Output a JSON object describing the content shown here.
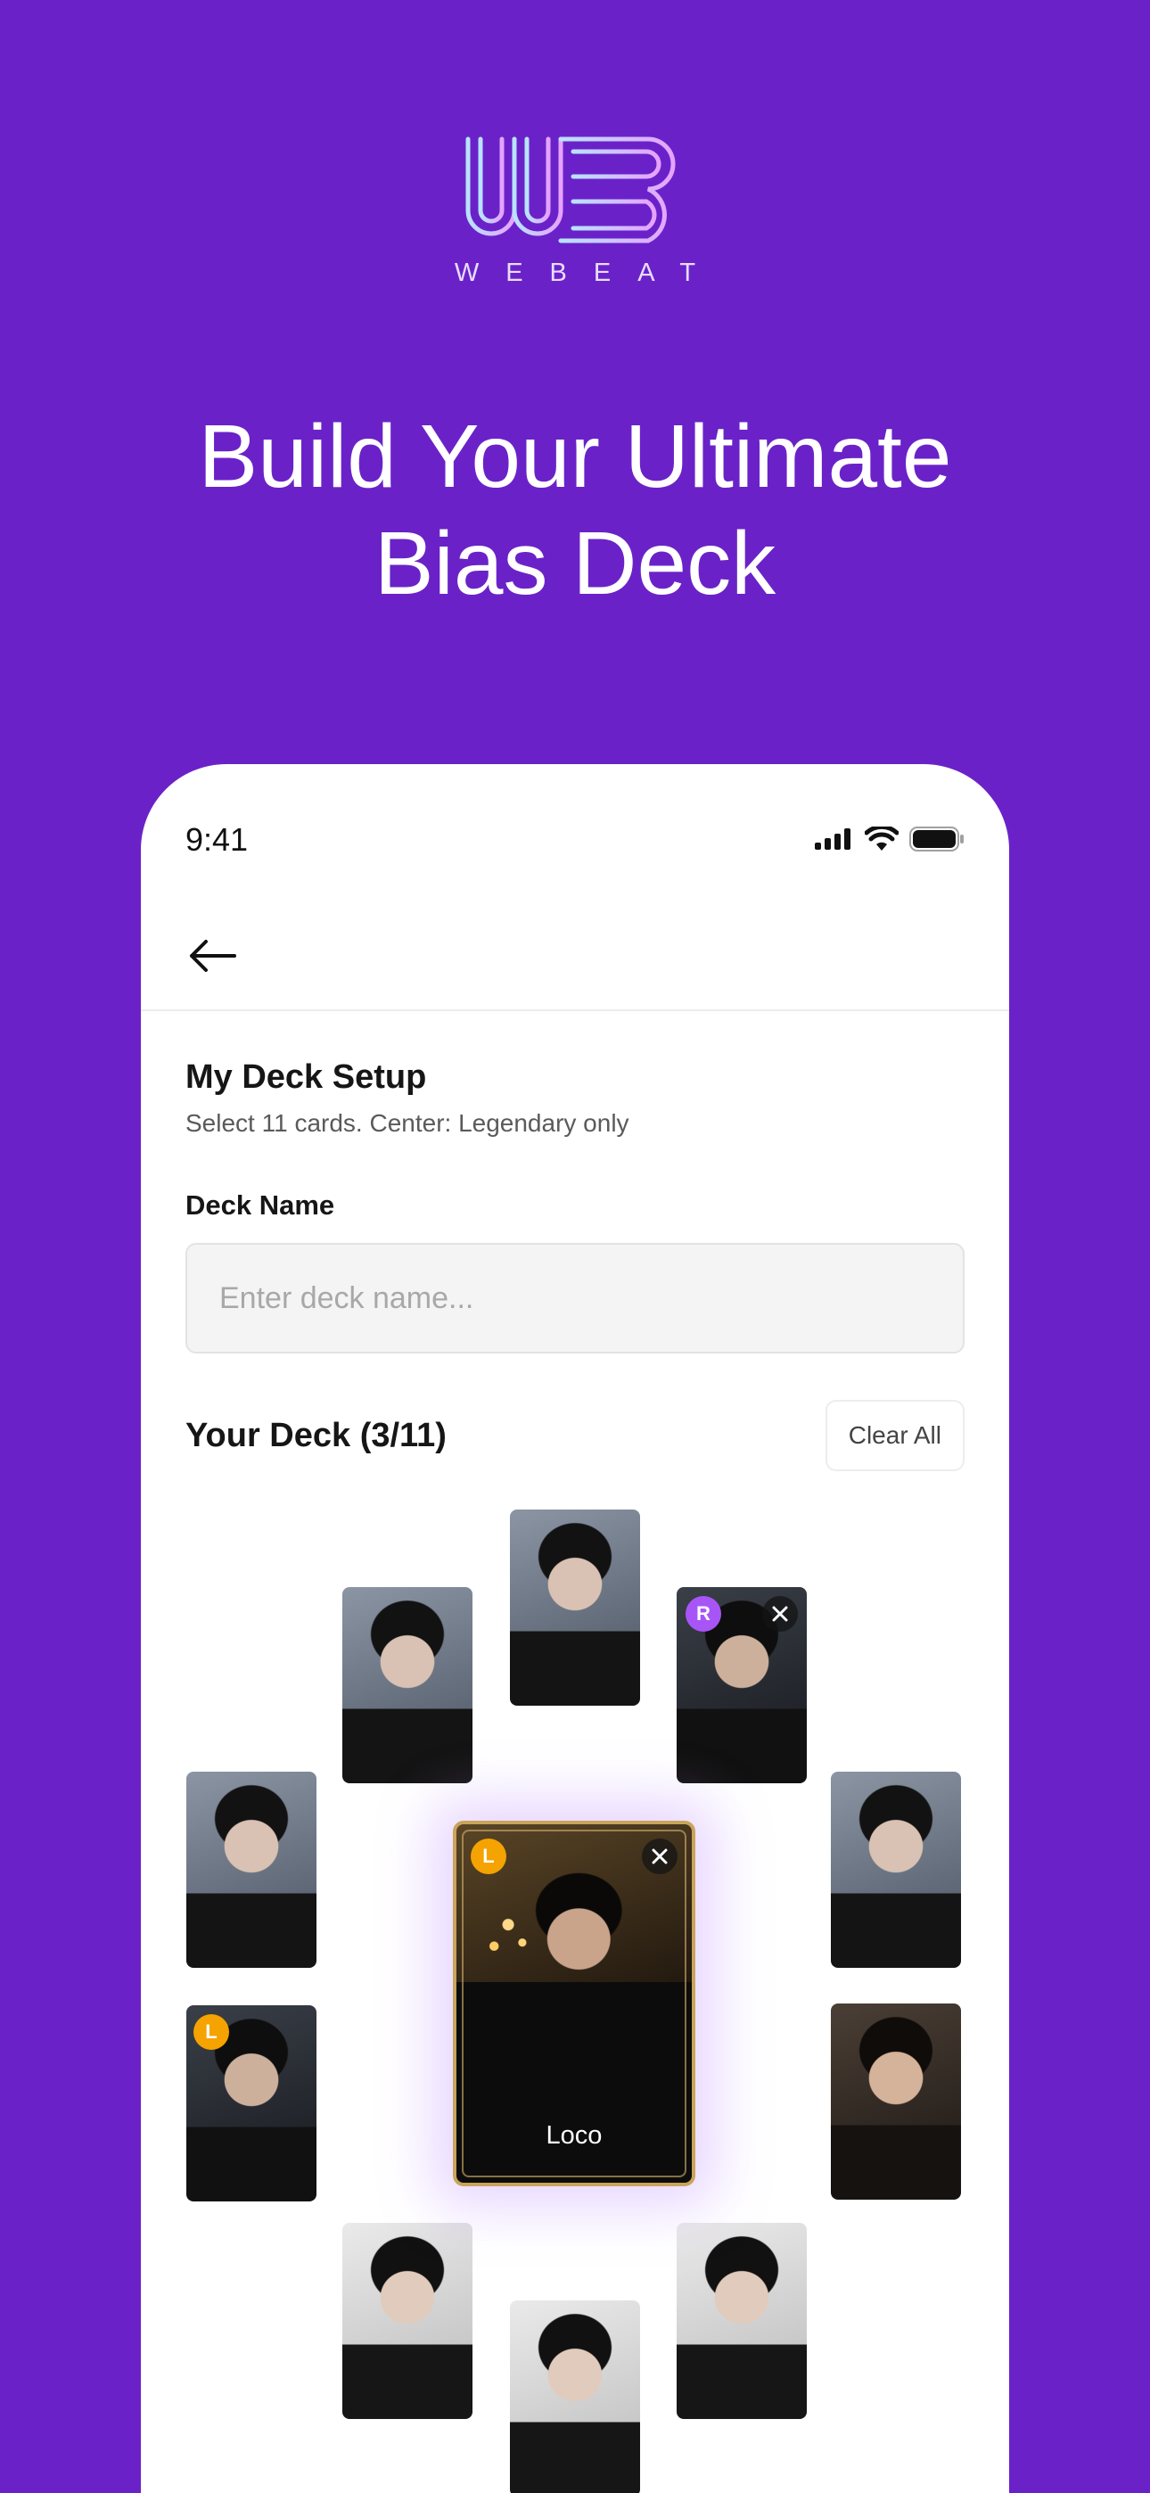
{
  "brand": {
    "wordmark": "WEBEAT",
    "logo_gradient": [
      "#b8e3ff",
      "#e7a2ff"
    ]
  },
  "hero": {
    "line1": "Build Your Ultimate",
    "line2": "Bias Deck"
  },
  "status_bar": {
    "time": "9:41",
    "icons": [
      "cellular-signal-icon",
      "wifi-icon",
      "battery-icon"
    ]
  },
  "nav": {
    "back_icon": "arrow-left-icon"
  },
  "deck_setup": {
    "title": "My Deck Setup",
    "subtitle": "Select 11 cards. Center: Legendary only",
    "deck_name_label": "Deck Name",
    "deck_name_value": "",
    "deck_name_placeholder": "Enter deck name...",
    "deck_title": "Your Deck (3/11)",
    "clear_all_label": "Clear All"
  },
  "cards": [
    {
      "slot": "top-center",
      "badge": "",
      "removable": false
    },
    {
      "slot": "upper-left",
      "badge": "",
      "removable": false
    },
    {
      "slot": "upper-right",
      "badge": "R",
      "removable": true
    },
    {
      "slot": "mid-left",
      "badge": "",
      "removable": false
    },
    {
      "slot": "mid-right",
      "badge": "",
      "removable": false
    },
    {
      "slot": "lower-left",
      "badge": "L",
      "removable": false
    },
    {
      "slot": "lower-right",
      "badge": "",
      "removable": false
    },
    {
      "slot": "bottom-left",
      "badge": "",
      "removable": false
    },
    {
      "slot": "bottom-right",
      "badge": "",
      "removable": false
    },
    {
      "slot": "bottom-center",
      "badge": "",
      "removable": false
    }
  ],
  "center_card": {
    "badge": "L",
    "name": "Loco",
    "removable": true,
    "remove_icon": "close-icon"
  },
  "colors": {
    "background": "#6a22c8",
    "rare_badge": "#a855f7",
    "legendary_badge": "#f5a300",
    "center_border": "#c9a45a"
  }
}
